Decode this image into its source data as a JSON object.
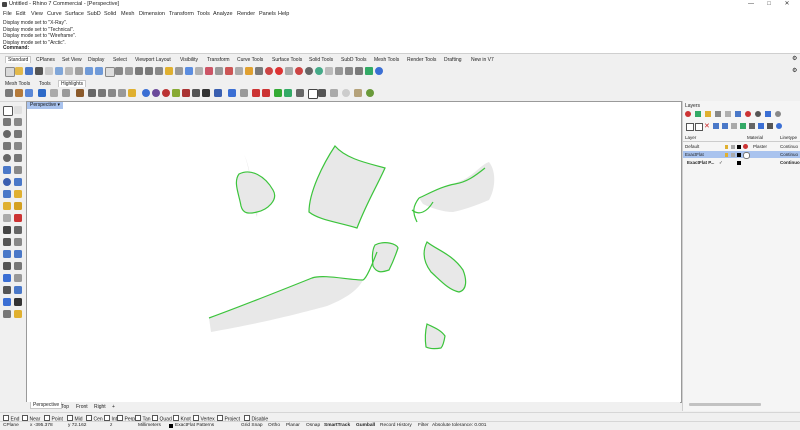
{
  "window": {
    "title": "Untitled - Rhino 7 Commercial - [Perspective]",
    "minimize": "—",
    "maximize": "□",
    "close": "✕"
  },
  "menus": [
    "File",
    "Edit",
    "View",
    "Curve",
    "Surface",
    "SubD",
    "Solid",
    "Mesh",
    "Dimension",
    "Transform",
    "Tools",
    "Analyze",
    "Render",
    "Panels",
    "Help"
  ],
  "command_history": [
    "Display mode set to \"X-Ray\".",
    "Display mode set to \"Technical\".",
    "Display mode set to \"Wireframe\".",
    "Display mode set to \"Arctic\"."
  ],
  "command_prompt": "Command:",
  "toolbar_tabs": [
    "Standard",
    "CPlanes",
    "Set View",
    "Display",
    "Select",
    "Viewport Layout",
    "Visibility",
    "Transform",
    "Curve Tools",
    "Surface Tools",
    "Solid Tools",
    "SubD Tools",
    "Mesh Tools",
    "Render Tools",
    "Drafting",
    "New in V7"
  ],
  "toolbar_tabs2": [
    "Mesh Tools",
    "Tools",
    "Highlights"
  ],
  "viewport": {
    "title": "Perspective",
    "title_arrow": "▾"
  },
  "viewport_tabs": [
    "Perspective",
    "Top",
    "Front",
    "Right"
  ],
  "viewport_add": "+",
  "layers": {
    "panel_title": "Layers",
    "headers": {
      "name": "Layer",
      "material": "Material",
      "linetype": "Linetype"
    },
    "rows": [
      {
        "name": "Default",
        "material": "Plaster",
        "linetype": "Continuo"
      },
      {
        "name": "ExactFlat",
        "material": "",
        "linetype": "Continuo"
      },
      {
        "name": "ExactFlat P...",
        "check": "✓",
        "material": "",
        "linetype": "Continuo"
      }
    ]
  },
  "osnaps": [
    "End",
    "Near",
    "Point",
    "Mid",
    "Cen",
    "Int",
    "Perp",
    "Tan",
    "Quad",
    "Knot",
    "Vertex",
    "Project",
    "Disable"
  ],
  "status": {
    "cplane": "CPlane",
    "x": "x -395.378",
    "y": "y 72.162",
    "z": "z",
    "units": "Millimeters",
    "layer": "ExactFlat Patterns",
    "grid_snap": "Grid Snap",
    "ortho": "Ortho",
    "planar": "Planar",
    "osnap": "Osnap",
    "smarttrack": "SmartTrack",
    "gumball": "Gumball",
    "record_history": "Record History",
    "filter": "Filter",
    "tolerance": "Absolute tolerance: 0.001"
  },
  "colors": {
    "curve": "#3cc43c",
    "surface": "#e8e8e8",
    "viewport_title": "#a9c3ee",
    "selected_layer": "#a9c3ee"
  }
}
